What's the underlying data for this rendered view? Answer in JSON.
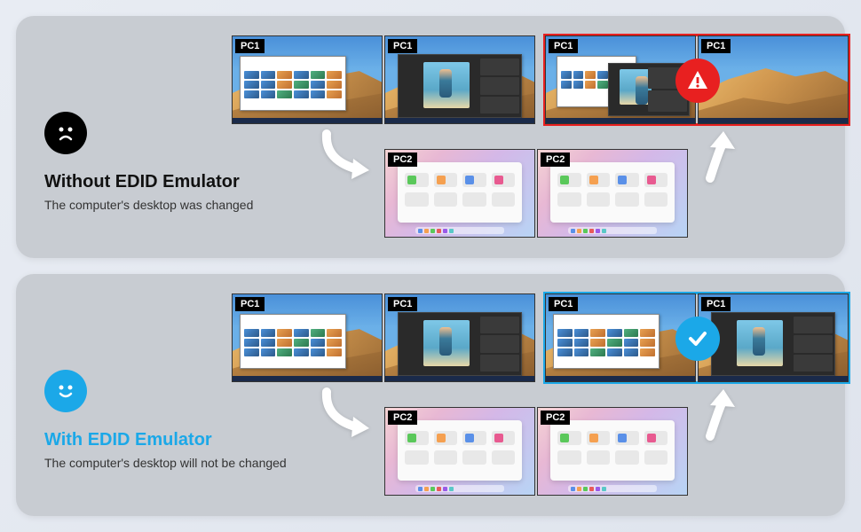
{
  "sections": {
    "without": {
      "title": "Without EDID Emulator",
      "subtitle": "The computer's desktop was changed"
    },
    "with": {
      "title": "With EDID Emulator",
      "subtitle": "The computer's desktop will not be changed"
    }
  },
  "labels": {
    "pc1": "PC1",
    "pc2": "PC2"
  },
  "colors": {
    "accent": "#1ba8e8",
    "warn": "#e82020"
  }
}
